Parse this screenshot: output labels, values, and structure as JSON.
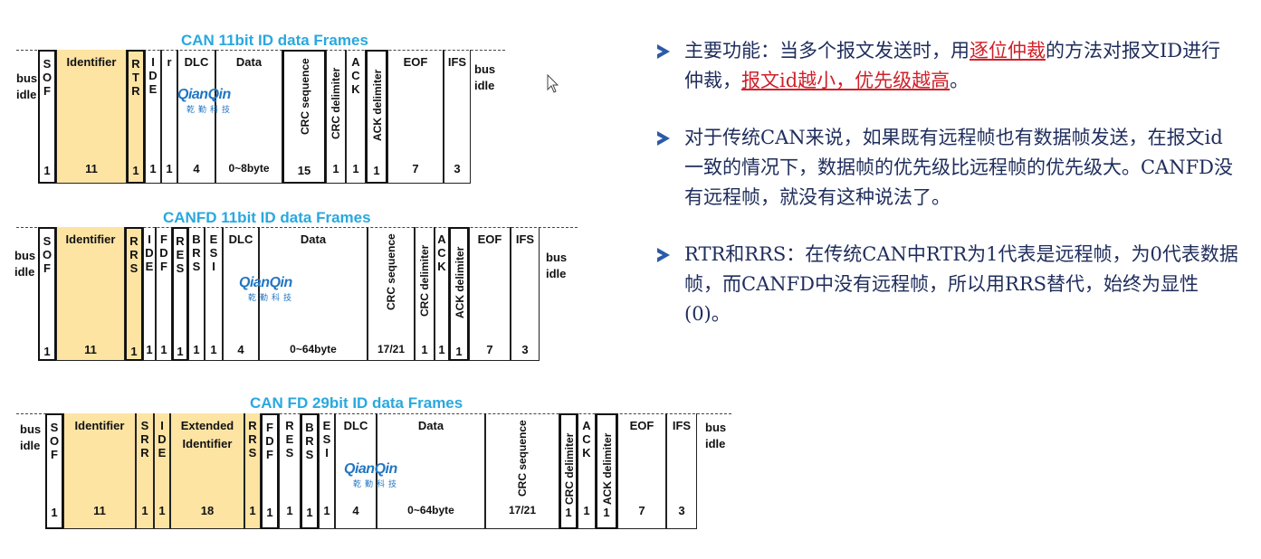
{
  "diagrams": [
    {
      "title": "CAN 11bit ID data Frames",
      "bus_left": "bus\nidle",
      "bus_right": "bus\nidle",
      "fields": [
        {
          "label": "S\nO\nF",
          "bits": "1"
        },
        {
          "label": "Identifier",
          "bits": "11"
        },
        {
          "label": "R\nT\nR",
          "bits": "1"
        },
        {
          "label": "I\nD\nE",
          "bits": "1"
        },
        {
          "label": "r",
          "bits": "1"
        },
        {
          "label": "DLC",
          "bits": "4"
        },
        {
          "label": "Data",
          "bits": "0~8byte"
        },
        {
          "label": "CRC sequence",
          "bits": "15"
        },
        {
          "label": "CRC delimiter",
          "bits": "1"
        },
        {
          "label": "A\nC\nK",
          "bits": "1"
        },
        {
          "label": "ACK delimiter",
          "bits": "1"
        },
        {
          "label": "EOF",
          "bits": "7"
        },
        {
          "label": "IFS",
          "bits": "3"
        }
      ]
    },
    {
      "title": "CANFD  11bit ID data Frames",
      "bus_left": "bus\nidle",
      "bus_right": "bus\nidle",
      "fields": [
        {
          "label": "S\nO\nF",
          "bits": "1"
        },
        {
          "label": "Identifier",
          "bits": "11"
        },
        {
          "label": "R\nR\nS",
          "bits": "1"
        },
        {
          "label": "I\nD\nE",
          "bits": "1"
        },
        {
          "label": "F\nD\nF",
          "bits": "1"
        },
        {
          "label": "R\nE\nS",
          "bits": "1"
        },
        {
          "label": "B\nR\nS",
          "bits": "1"
        },
        {
          "label": "E\nS\nI",
          "bits": "1"
        },
        {
          "label": "DLC",
          "bits": "4"
        },
        {
          "label": "Data",
          "bits": "0~64byte"
        },
        {
          "label": "CRC sequence",
          "bits": "17/21"
        },
        {
          "label": "CRC delimiter",
          "bits": "1"
        },
        {
          "label": "A\nC\nK",
          "bits": "1"
        },
        {
          "label": "ACK delimiter",
          "bits": "1"
        },
        {
          "label": "EOF",
          "bits": "7"
        },
        {
          "label": "IFS",
          "bits": "3"
        }
      ]
    },
    {
      "title": "CAN FD 29bit ID data Frames",
      "bus_left": "bus\nidle",
      "bus_right": "bus\nidle",
      "fields": [
        {
          "label": "S\nO\nF",
          "bits": "1"
        },
        {
          "label": "Identifier",
          "bits": "11"
        },
        {
          "label": "S\nR\nR",
          "bits": "1"
        },
        {
          "label": "I\nD\nE",
          "bits": "1"
        },
        {
          "label": "Extended\nIdentifier",
          "bits": "18"
        },
        {
          "label": "R\nR\nS",
          "bits": "1"
        },
        {
          "label": "F\nD\nF",
          "bits": "1"
        },
        {
          "label": "R\nE\nS",
          "bits": "1"
        },
        {
          "label": "B\nR\nS",
          "bits": "1"
        },
        {
          "label": "E\nS\nI",
          "bits": "1"
        },
        {
          "label": "DLC",
          "bits": "4"
        },
        {
          "label": "Data",
          "bits": "0~64byte"
        },
        {
          "label": "CRC sequence",
          "bits": "17/21"
        },
        {
          "label": "CRC delimiter",
          "bits": "1"
        },
        {
          "label": "A\nC\nK",
          "bits": "1"
        },
        {
          "label": "ACK delimiter",
          "bits": "1"
        },
        {
          "label": "EOF",
          "bits": "7"
        },
        {
          "label": "IFS",
          "bits": "3"
        }
      ]
    }
  ],
  "logo": {
    "brand": "QianQin",
    "cn": "乾勤科技"
  },
  "bullets": [
    {
      "parts": [
        "主要功能：当多个报文发送时，用",
        "逐位仲裁",
        "的方法对报文ID进行仲裁，",
        "报文id越小，优先级越高",
        "。"
      ]
    },
    {
      "text": "对于传统CAN来说，如果既有远程帧也有数据帧发送，在报文id一致的情况下，数据帧的优先级比远程帧的优先级大。CANFD没有远程帧，就没有这种说法了。"
    },
    {
      "text": "RTR和RRS：在传统CAN中RTR为1代表是远程帧，为0代表数据帧，而CANFD中没有远程帧，所以用RRS替代，始终为显性(0)。"
    }
  ],
  "colors": {
    "title": "#29a8df",
    "highlight": "#d0202a",
    "body_text": "#1f2d5c",
    "field_fill": "#fde4a3",
    "logo": "#2176c2"
  }
}
